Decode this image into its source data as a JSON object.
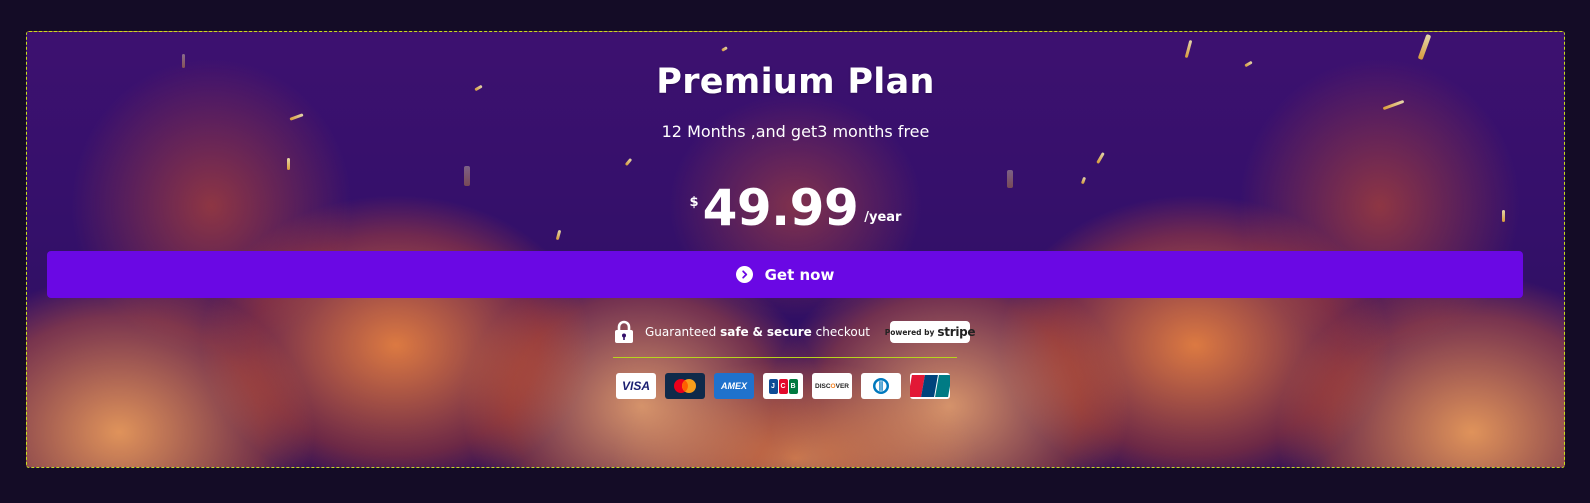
{
  "plan": {
    "title": "Premium Plan",
    "subtitle": "12 Months ,and get3 months free",
    "currency": "$",
    "price": "49.99",
    "period": "/year"
  },
  "cta": {
    "label": "Get now",
    "icon": "chevron-right-circle-icon"
  },
  "secure": {
    "prefix": "Guaranteed",
    "safe": "safe",
    "amp": "&",
    "secure_word": "secure",
    "suffix": "checkout",
    "lock_icon": "lock-icon",
    "stripe_powered": "Powered by",
    "stripe_brand": "stripe"
  },
  "payment_methods": {
    "visa": "VISA",
    "amex": "AMEX",
    "jcb_j": "J",
    "jcb_c": "C",
    "jcb_b": "B",
    "discover": "DISC",
    "discover_o": "O",
    "discover_end": "VER"
  },
  "colors": {
    "page_bg": "#140c26",
    "card_bg": "#34106a",
    "cta": "#6a08e4",
    "dashed_border": "#c6df1a",
    "divider": "#b8d41d"
  }
}
